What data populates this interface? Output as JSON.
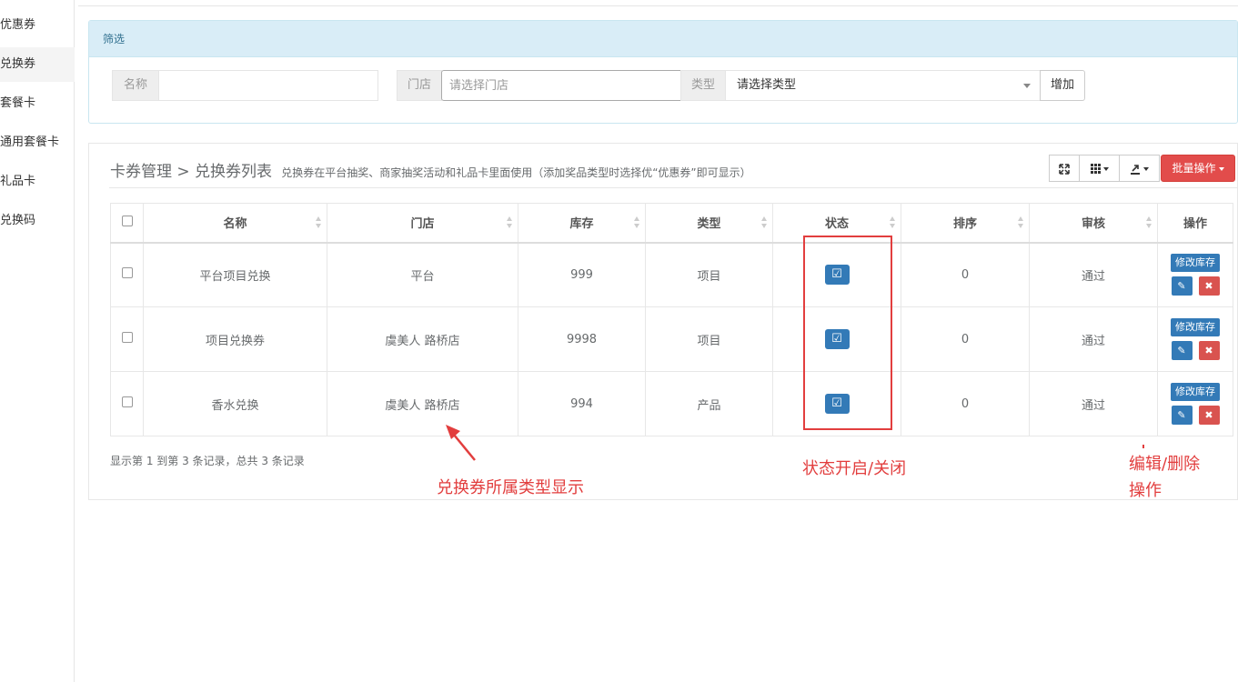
{
  "sidebar": {
    "items": [
      {
        "label": "优惠券"
      },
      {
        "label": "兑换券"
      },
      {
        "label": "套餐卡"
      },
      {
        "label": "通用套餐卡"
      },
      {
        "label": "礼品卡"
      },
      {
        "label": "兑换码"
      }
    ]
  },
  "filter": {
    "heading": "筛选",
    "name_label": "名称",
    "name_value": "",
    "store_label": "门店",
    "store_placeholder": "请选择门店",
    "type_label": "类型",
    "type_selected": "请选择类型",
    "add_label": "增加"
  },
  "panel": {
    "breadcrumb": "卡券管理 > 兑换券列表",
    "subtitle": "兑换券在平台抽奖、商家抽奖活动和礼品卡里面使用（添加奖品类型时选择优“优惠券”即可显示）",
    "batch_label": "批量操作",
    "footer": "显示第 1 到第 3 条记录，总共 3 条记录"
  },
  "table": {
    "columns": [
      "名称",
      "门店",
      "库存",
      "类型",
      "状态",
      "排序",
      "审核",
      "操作"
    ],
    "rows": [
      {
        "name": "平台项目兑换",
        "store": "平台",
        "stock": "999",
        "type": "项目",
        "sort": "0",
        "review": "通过"
      },
      {
        "name": "项目兑换券",
        "store": "虞美人 路桥店",
        "stock": "9998",
        "type": "项目",
        "sort": "0",
        "review": "通过"
      },
      {
        "name": "香水兑换",
        "store": "虞美人 路桥店",
        "stock": "994",
        "type": "产品",
        "sort": "0",
        "review": "通过"
      }
    ],
    "stock_button": "修改库存"
  },
  "annotations": {
    "type_note": "兑换券所属类型显示",
    "status_note": "状态开启/关闭",
    "ops_note_1": "编辑/删除",
    "ops_note_2": "操作"
  },
  "icons": {
    "fullscreen": "expand-icon",
    "columns": "grid-icon",
    "export": "export-icon",
    "status": "checkbox-checked-icon",
    "edit": "edit-icon",
    "delete": "times-icon"
  },
  "colors": {
    "primary": "#337ab7",
    "danger": "#d9534f",
    "annotation": "#e23e3e",
    "filter_header": "#d9edf7"
  }
}
